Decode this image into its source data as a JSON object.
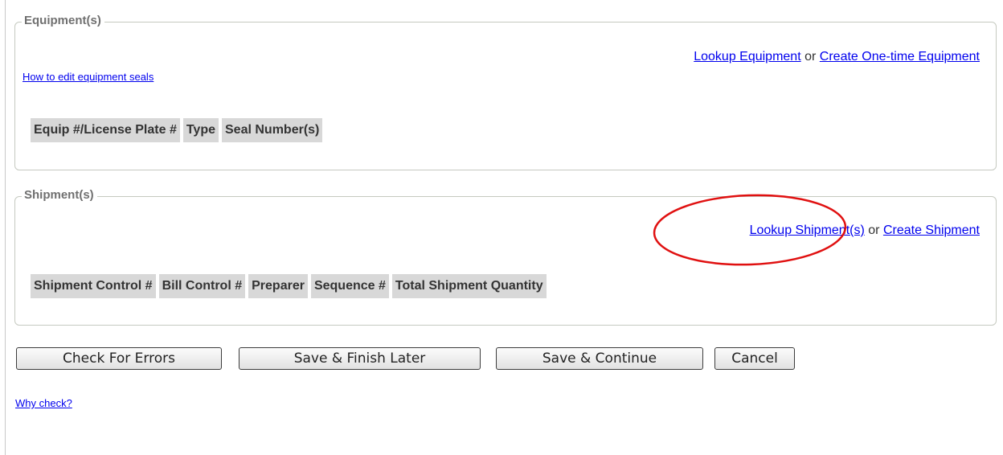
{
  "equipment": {
    "legend": "Equipment(s)",
    "lookup_link": "Lookup Equipment",
    "or_text": "or",
    "create_link": "Create One-time Equipment",
    "help_link": "How to edit equipment seals",
    "columns": [
      "Equip #/License Plate #",
      "Type",
      "Seal Number(s)"
    ]
  },
  "shipment": {
    "legend": "Shipment(s)",
    "lookup_link": "Lookup Shipment(s)",
    "or_text": "or",
    "create_link": "Create Shipment",
    "columns": [
      "Shipment Control #",
      "Bill Control #",
      "Preparer",
      "Sequence #",
      "Total Shipment Quantity"
    ]
  },
  "buttons": {
    "check_errors": "Check For Errors",
    "save_finish_later": "Save & Finish Later",
    "save_continue": "Save & Continue",
    "cancel": "Cancel"
  },
  "why_check_link": "Why check?",
  "colors": {
    "link": "#0000ee",
    "header_bg": "#d8d8d8",
    "annotation": "#e01010"
  }
}
